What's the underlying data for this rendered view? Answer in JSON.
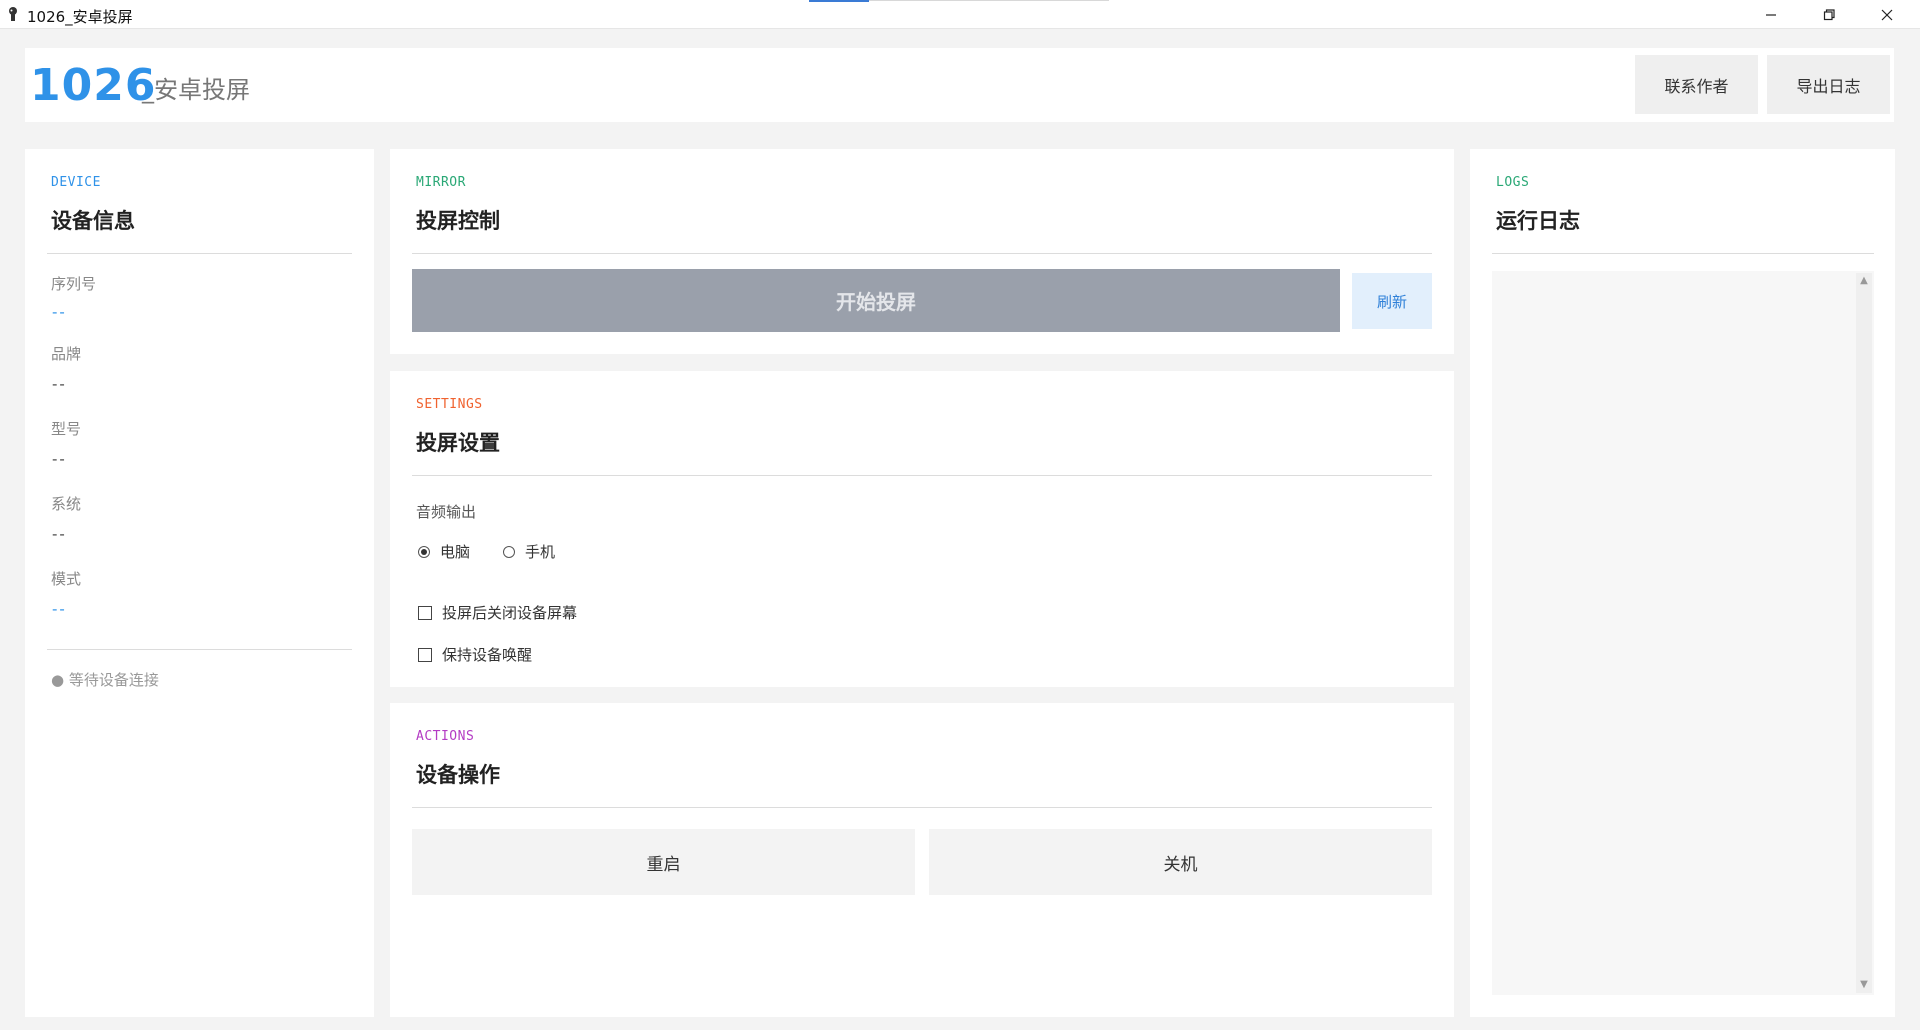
{
  "window": {
    "title": "1026_安卓投屏",
    "controls": [
      "minimize-icon",
      "restore-icon",
      "close-icon"
    ]
  },
  "header": {
    "brand_number": "1026",
    "brand_name": "_安卓投屏",
    "contact_label": "联系作者",
    "export_label": "导出日志"
  },
  "device": {
    "tag": "DEVICE",
    "title": "设备信息",
    "fields": [
      {
        "label": "序列号",
        "value": "--"
      },
      {
        "label": "品牌",
        "value": "--"
      },
      {
        "label": "型号",
        "value": "--"
      },
      {
        "label": "系统",
        "value": "--"
      },
      {
        "label": "模式",
        "value": "--"
      }
    ],
    "status": "● 等待设备连接"
  },
  "mirror": {
    "tag": "MIRROR",
    "title": "投屏控制",
    "start_label": "开始投屏",
    "refresh_label": "刷新"
  },
  "settings": {
    "tag": "SETTINGS",
    "title": "投屏设置",
    "audio_label": "音频输出",
    "audio_options": [
      {
        "label": "电脑",
        "selected": true
      },
      {
        "label": "手机",
        "selected": false
      }
    ],
    "checkboxes": [
      {
        "label": "投屏后关闭设备屏幕",
        "checked": false
      },
      {
        "label": "保持设备唤醒",
        "checked": false
      }
    ]
  },
  "actions": {
    "tag": "ACTIONS",
    "title": "设备操作",
    "reboot_label": "重启",
    "shutdown_label": "关机"
  },
  "logs": {
    "tag": "LOGS",
    "title": "运行日志"
  },
  "colors": {
    "device_tag": "#2f92e8",
    "mirror_tag": "#2aa876",
    "settings_tag": "#f0622f",
    "actions_tag": "#b43cc4",
    "logs_tag": "#2aa876",
    "brand_blue": "#2f92e8"
  }
}
